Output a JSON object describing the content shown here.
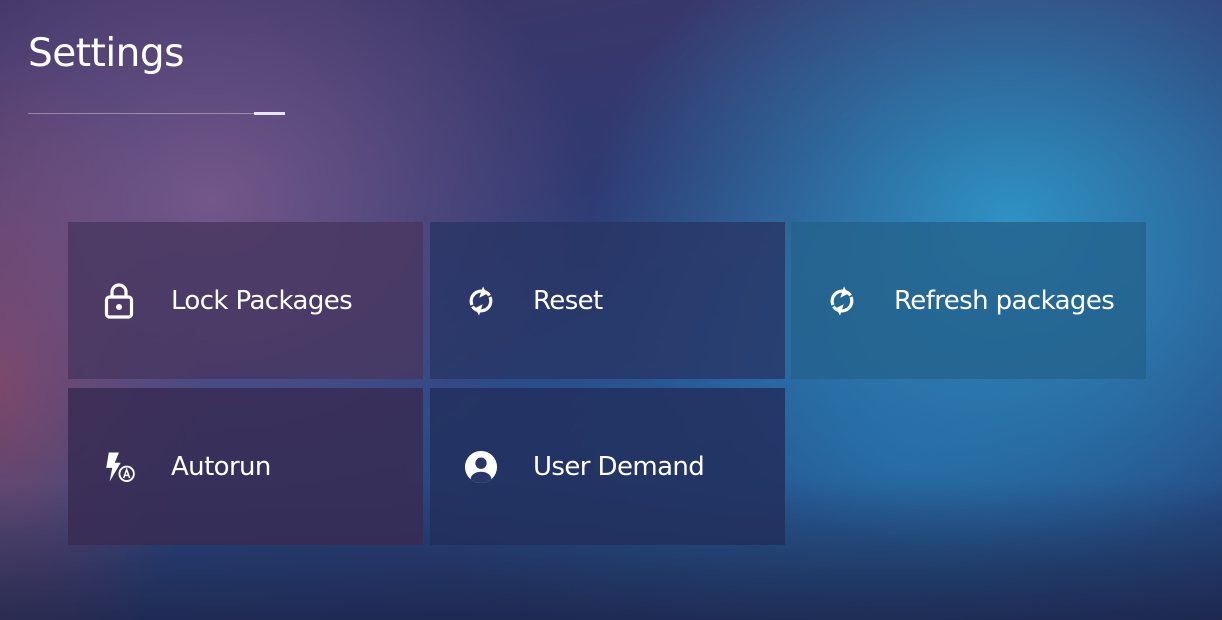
{
  "header": {
    "title": "Settings"
  },
  "tiles": [
    {
      "label": "Lock Packages",
      "icon": "lock-icon"
    },
    {
      "label": "Reset",
      "icon": "refresh-icon"
    },
    {
      "label": "Refresh packages",
      "icon": "refresh-icon"
    },
    {
      "label": "Autorun",
      "icon": "flash-auto-icon"
    },
    {
      "label": "User Demand",
      "icon": "account-circle-icon"
    }
  ],
  "colors": {
    "text": "#ffffff",
    "tile_purple": "#483760",
    "tile_navy": "#283464",
    "tile_teal": "#24628c"
  }
}
